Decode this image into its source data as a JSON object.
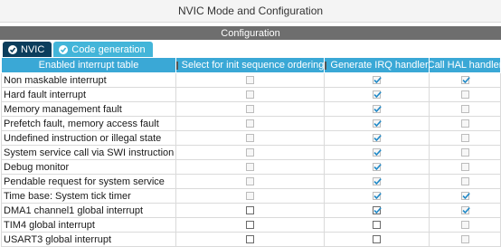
{
  "title": "NVIC Mode and Configuration",
  "section": "Configuration",
  "tabs": [
    {
      "label": "NVIC",
      "active": true
    },
    {
      "label": "Code generation",
      "active": false
    }
  ],
  "columns": {
    "name": "Enabled interrupt table",
    "select": "Select for init sequence ordering",
    "irq": "Generate IRQ handler",
    "hal": "Call HAL handler"
  },
  "rows": [
    {
      "name": "Non maskable interrupt",
      "select": false,
      "select_enabled": false,
      "irq": true,
      "irq_enabled": false,
      "hal": true,
      "hal_enabled": false
    },
    {
      "name": "Hard fault interrupt",
      "select": false,
      "select_enabled": false,
      "irq": true,
      "irq_enabled": false,
      "hal": false,
      "hal_enabled": false
    },
    {
      "name": "Memory management fault",
      "select": false,
      "select_enabled": false,
      "irq": true,
      "irq_enabled": false,
      "hal": false,
      "hal_enabled": false
    },
    {
      "name": "Prefetch fault, memory access fault",
      "select": false,
      "select_enabled": false,
      "irq": true,
      "irq_enabled": false,
      "hal": false,
      "hal_enabled": false
    },
    {
      "name": "Undefined instruction or illegal state",
      "select": false,
      "select_enabled": false,
      "irq": true,
      "irq_enabled": false,
      "hal": false,
      "hal_enabled": false
    },
    {
      "name": "System service call via SWI instruction",
      "select": false,
      "select_enabled": false,
      "irq": true,
      "irq_enabled": false,
      "hal": false,
      "hal_enabled": false
    },
    {
      "name": "Debug monitor",
      "select": false,
      "select_enabled": false,
      "irq": true,
      "irq_enabled": false,
      "hal": false,
      "hal_enabled": false
    },
    {
      "name": "Pendable request for system service",
      "select": false,
      "select_enabled": false,
      "irq": true,
      "irq_enabled": false,
      "hal": false,
      "hal_enabled": false
    },
    {
      "name": "Time base: System tick timer",
      "select": false,
      "select_enabled": false,
      "irq": true,
      "irq_enabled": false,
      "hal": true,
      "hal_enabled": false
    },
    {
      "name": "DMA1 channel1 global interrupt",
      "select": false,
      "select_enabled": true,
      "irq": true,
      "irq_enabled": true,
      "hal": true,
      "hal_enabled": false
    },
    {
      "name": "TIM4 global interrupt",
      "select": false,
      "select_enabled": true,
      "irq": false,
      "irq_enabled": true,
      "hal": false,
      "hal_enabled": false
    },
    {
      "name": "USART3 global interrupt",
      "select": false,
      "select_enabled": true,
      "irq": false,
      "irq_enabled": true,
      "hal": false,
      "hal_enabled": false
    }
  ],
  "colors": {
    "header": "#3aa8d6",
    "tab_active": "#0b3d5c",
    "tab_inactive": "#43b5d9",
    "section_bar": "#6e6e6e",
    "check": "#1e88c7"
  }
}
